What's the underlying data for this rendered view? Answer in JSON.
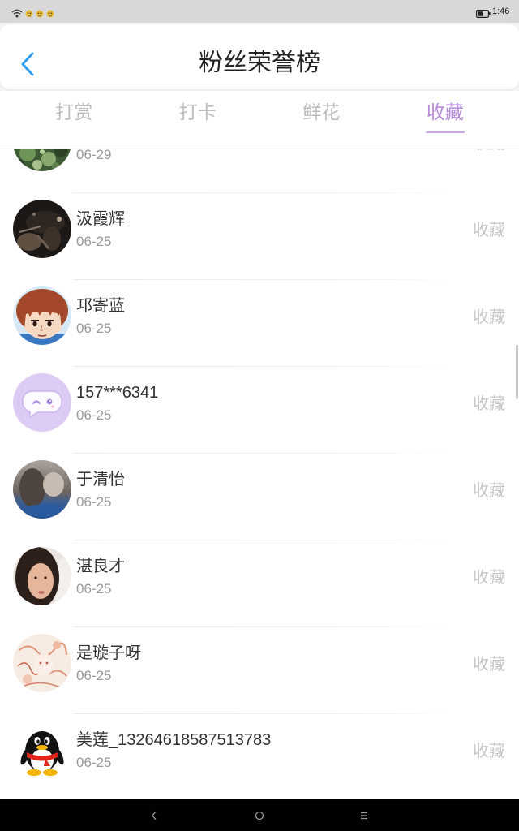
{
  "status_bar": {
    "time": "1:46",
    "icons": [
      "wifi-icon",
      "notification-icon",
      "notification-icon",
      "notification-icon",
      "battery-icon"
    ]
  },
  "header": {
    "title": "粉丝荣誉榜",
    "back_icon": "chevron-left-icon"
  },
  "tabs": [
    {
      "label": "打赏",
      "active": false
    },
    {
      "label": "打卡",
      "active": false
    },
    {
      "label": "鲜花",
      "active": false
    },
    {
      "label": "收藏",
      "active": true
    }
  ],
  "list": {
    "items": [
      {
        "date": "06-29",
        "action": "收藏"
      },
      {
        "name": "汲霞辉",
        "date": "06-25",
        "action": "收藏"
      },
      {
        "name": "邛寄蓝",
        "date": "06-25",
        "action": "收藏"
      },
      {
        "name": "157***6341",
        "date": "06-25",
        "action": "收藏"
      },
      {
        "name": "于清怡",
        "date": "06-25",
        "action": "收藏"
      },
      {
        "name": "湛良才",
        "date": "06-25",
        "action": "收藏"
      },
      {
        "name": "是璇子呀",
        "date": "06-25",
        "action": "收藏"
      },
      {
        "name": "美莲_13264618587513783",
        "date": "06-25",
        "action": "收藏"
      }
    ]
  },
  "nav_bar": {
    "icons": [
      "nav-back-icon",
      "nav-home-icon",
      "nav-recents-icon"
    ]
  },
  "colors": {
    "accent": "#b58ad9",
    "accent_line": "#c9a6ea",
    "back_icon": "#2d9cf0",
    "inactive_tab": "#bdbdbd",
    "action_label": "#c6c6c6",
    "status_bar": "#d8d8d8",
    "nav_bar": "#000000"
  }
}
